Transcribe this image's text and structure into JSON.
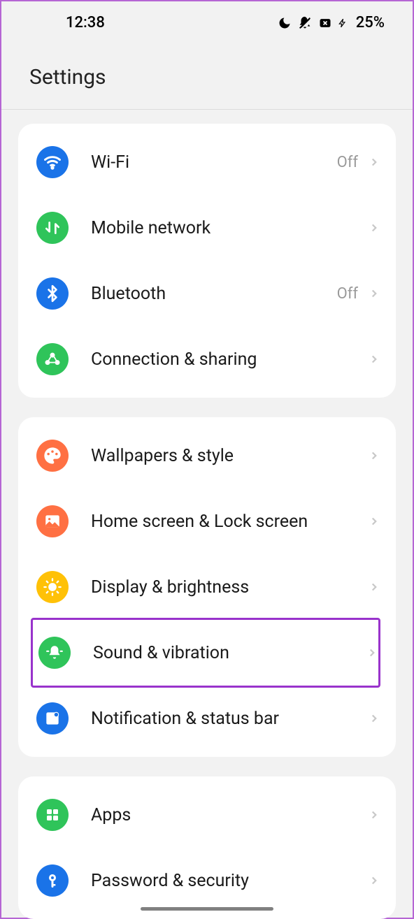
{
  "statusBar": {
    "time": "12:38",
    "battery": "25%"
  },
  "title": "Settings",
  "groups": [
    {
      "items": [
        {
          "icon": "wifi",
          "bg": "bg-blue",
          "label": "Wi-Fi",
          "status": "Off"
        },
        {
          "icon": "mobile",
          "bg": "bg-green",
          "label": "Mobile network",
          "status": ""
        },
        {
          "icon": "bluetooth",
          "bg": "bg-blue",
          "label": "Bluetooth",
          "status": "Off"
        },
        {
          "icon": "connection",
          "bg": "bg-green",
          "label": "Connection & sharing",
          "status": ""
        }
      ]
    },
    {
      "items": [
        {
          "icon": "palette",
          "bg": "bg-orange",
          "label": "Wallpapers & style",
          "status": ""
        },
        {
          "icon": "image",
          "bg": "bg-orange",
          "label": "Home screen & Lock screen",
          "status": ""
        },
        {
          "icon": "sun",
          "bg": "bg-yellow",
          "label": "Display & brightness",
          "status": ""
        },
        {
          "icon": "bell",
          "bg": "bg-green",
          "label": "Sound & vibration",
          "status": "",
          "highlight": true
        },
        {
          "icon": "notification",
          "bg": "bg-blue",
          "label": "Notification & status bar",
          "status": ""
        }
      ]
    },
    {
      "items": [
        {
          "icon": "apps",
          "bg": "bg-green",
          "label": "Apps",
          "status": ""
        },
        {
          "icon": "key",
          "bg": "bg-blue",
          "label": "Password & security",
          "status": ""
        }
      ]
    }
  ]
}
